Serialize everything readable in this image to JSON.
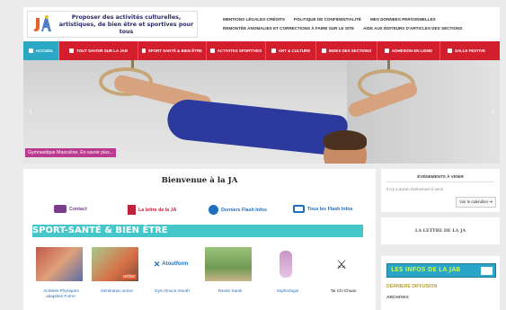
{
  "header": {
    "tagline": "Proposer des activités culturelles, artistiques, de bien être et sportives pour tous",
    "top_links_row1": [
      "MENTIONS LÉGALES-CRÉDITS",
      "POLITIQUE DE CONFIDENTIALITÉ",
      "MES DONNEES PERSONNELLES"
    ],
    "top_links_row2": [
      "REMONTÉE ANOMALIES ET CORRECTIONS À FAIRE SUR LE SITE",
      "AIDE AUX ÉDITEURS D'ARTICLES DES SECTIONS"
    ]
  },
  "nav": {
    "items": [
      {
        "label": "ACCUEIL",
        "active": true,
        "icon": "home-icon"
      },
      {
        "label": "TOUT SAVOIR SUR LA JAB",
        "icon": "info-icon"
      },
      {
        "label": "SPORT SANTÉ & BIEN ÊTRE",
        "icon": "heart-icon"
      },
      {
        "label": "ACTIVITES SPORTIVES",
        "icon": "sport-icon"
      },
      {
        "label": "ART & CULTURE",
        "icon": "art-icon"
      },
      {
        "label": "INDEX DES SECTIONS",
        "icon": "index-icon"
      },
      {
        "label": "ADHÉSION EN LIGNE",
        "icon": "membership-icon"
      },
      {
        "label": "SALLE FESTIVE",
        "icon": "venue-icon"
      }
    ]
  },
  "slider": {
    "caption": "Gymnastique Masculine. En savoir plus...",
    "prev_icon": "chevron-left-icon",
    "next_icon": "chevron-right-icon"
  },
  "main": {
    "welcome": "Bienvenue à la JA",
    "quick_links": [
      {
        "label": "Contact",
        "color": "#7a3d8f"
      },
      {
        "label": "La lettre de la JA",
        "color": "#c0223a"
      },
      {
        "label": "Derniers Flash Infos",
        "color": "#1f6fc1"
      },
      {
        "label": "Tous les Flash Infos",
        "color": "#1f6fc1"
      }
    ],
    "section_title": "SPORT-SANTÉ & BIEN ÊTRE",
    "cards": [
      {
        "label": "Activités Physiques adaptées Form+"
      },
      {
        "label": "Génération active"
      },
      {
        "label": "Gym Douce Atoutf+"
      },
      {
        "label": "Rando Santé"
      },
      {
        "label": "Sophrologie"
      },
      {
        "label": "Tai Chi Chuan"
      }
    ],
    "card_overlay": "active",
    "atoutform_logo_text": "Atoutform"
  },
  "sidebar": {
    "events_title": "ÉVÉNEMENTS À VENIR",
    "events_empty": "Il n'y a aucun événement à venir",
    "calendar_button": "Voir le calendrier ➔",
    "lettre_title": "LA LETTRE DE LA JA",
    "infos_banner": "LES INFOS DE LA JAB",
    "derniere": "DERNIERE DIFFUSION",
    "archives": "ARCHIVES"
  },
  "colors": {
    "nav_red": "#d21e2d",
    "nav_active": "#2aa8c4",
    "section_teal": "#45c6c9",
    "caption_magenta": "#b93a8f"
  }
}
